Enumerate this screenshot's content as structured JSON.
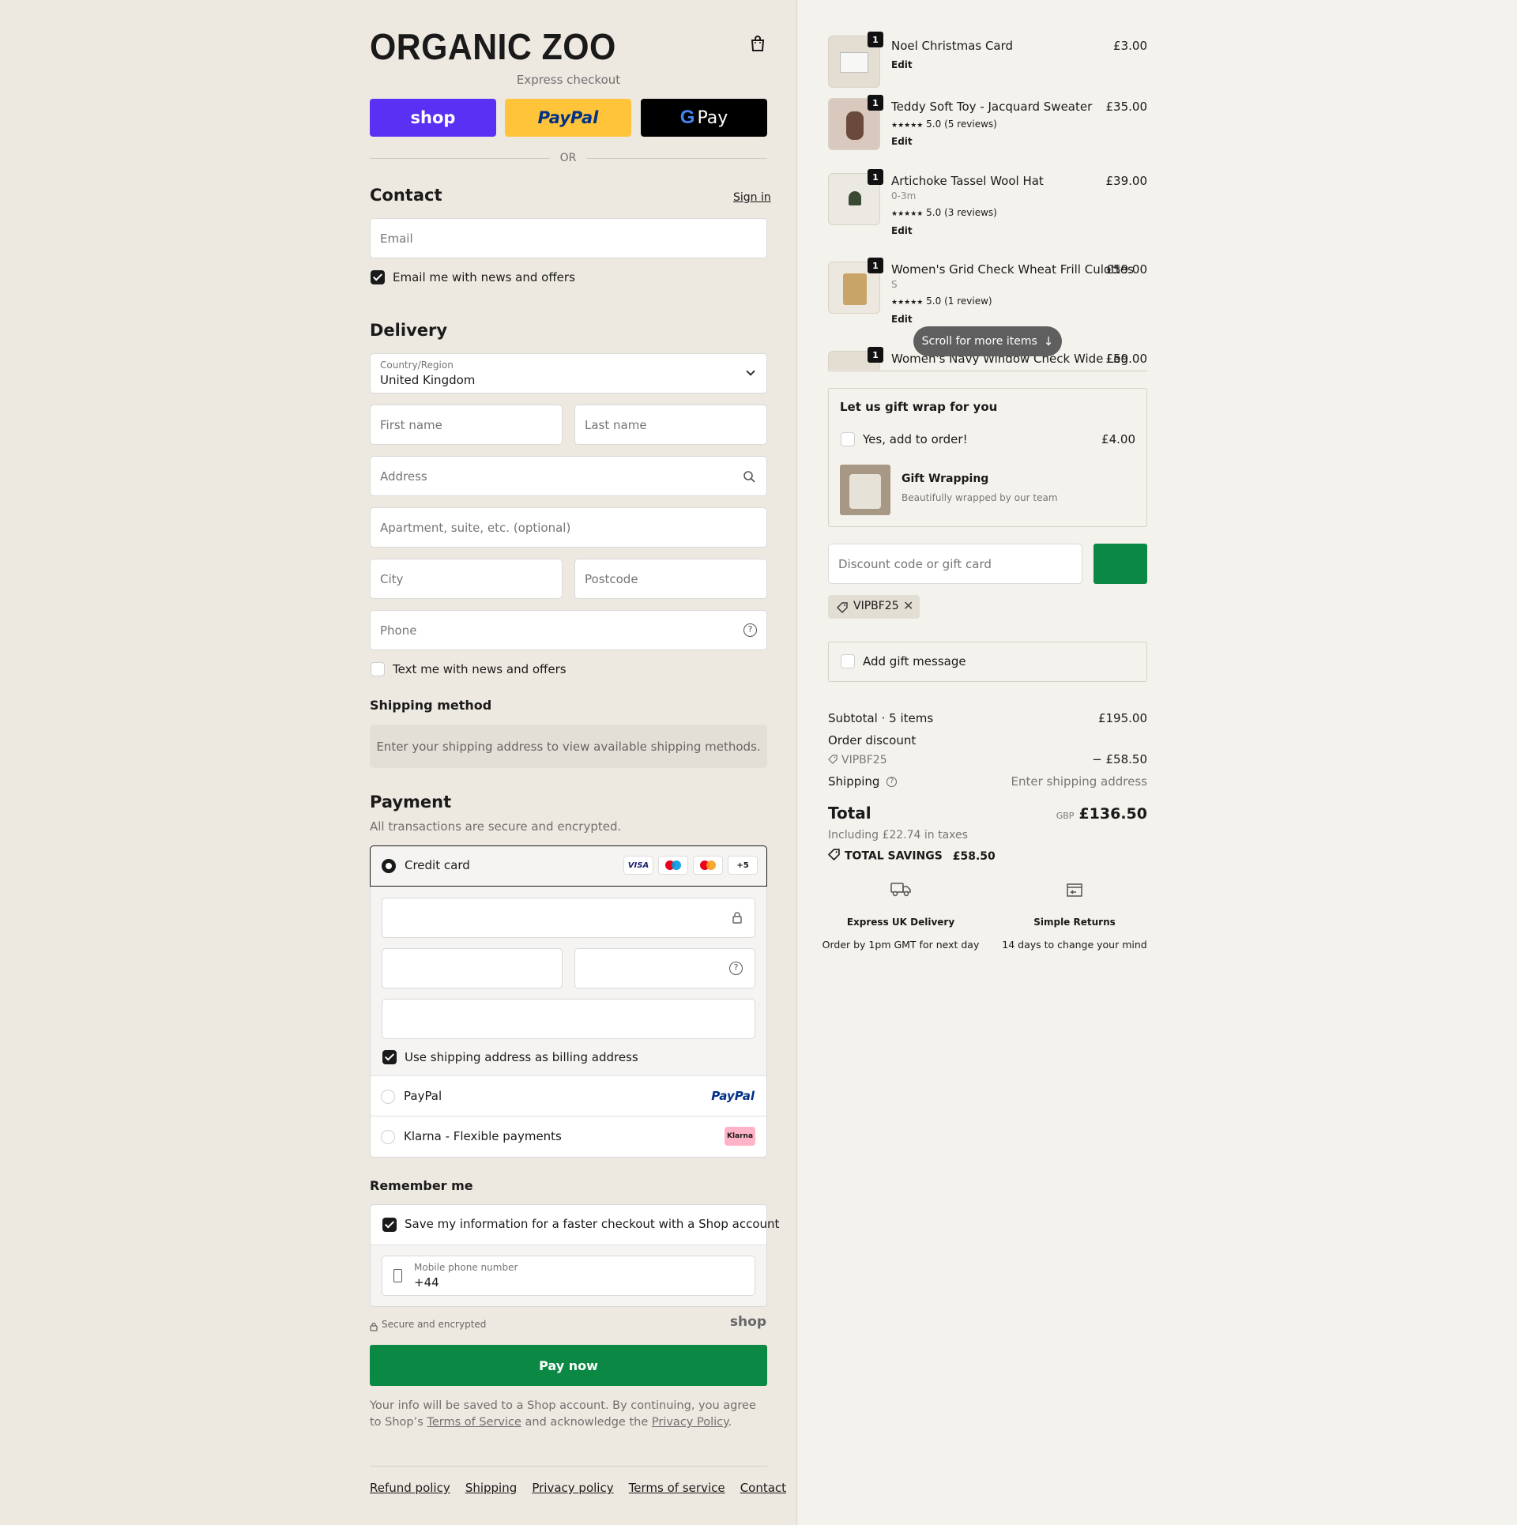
{
  "brand": {
    "logo": "ORGANIC ZOO"
  },
  "express": {
    "label": "Express checkout",
    "shop_label": "shop",
    "paypal_label": "PayPal",
    "gpay_label": "Pay",
    "or_label": "OR",
    "shop_color": "#5a31f4",
    "paypal_color": "#ffc439",
    "gpay_color": "#000000"
  },
  "contact": {
    "title": "Contact",
    "sign_in": "Sign in",
    "email_placeholder": "Email",
    "email_news_label": "Email me with news and offers",
    "email_news_checked": true
  },
  "delivery": {
    "title": "Delivery",
    "country_label": "Country/Region",
    "country_value": "United Kingdom",
    "first_name_placeholder": "First name",
    "last_name_placeholder": "Last name",
    "address_placeholder": "Address",
    "apartment_placeholder": "Apartment, suite, etc. (optional)",
    "city_placeholder": "City",
    "postcode_placeholder": "Postcode",
    "phone_placeholder": "Phone",
    "text_news_label": "Text me with news and offers",
    "text_news_checked": false
  },
  "shipping_method": {
    "title": "Shipping method",
    "notice": "Enter your shipping address to view available shipping methods."
  },
  "payment": {
    "title": "Payment",
    "subtitle": "All transactions are secure and encrypted.",
    "credit_card_label": "Credit card",
    "card_badges": [
      "VISA",
      "+5"
    ],
    "billing_label": "Use shipping address as billing address",
    "billing_checked": true,
    "paypal_option": "PayPal",
    "paypal_logo": "PayPal",
    "klarna_option": "Klarna - Flexible payments",
    "klarna_logo": "Klarna"
  },
  "remember": {
    "title": "Remember me",
    "save_label": "Save my information for a faster checkout with a Shop account",
    "save_checked": true,
    "mobile_label": "Mobile phone number",
    "mobile_value": "+44",
    "secure_label": "Secure and encrypted",
    "shop_mark": "shop"
  },
  "pay_button": {
    "label": "Pay now",
    "color": "#0b8843"
  },
  "legal": {
    "text_1": "Your info will be saved to a Shop account. By continuing, you agree to Shop’s",
    "terms": "Terms of Service",
    "text_2": "and acknowledge the",
    "privacy": "Privacy Policy",
    "text_3": "."
  },
  "footer": {
    "links": [
      "Refund policy",
      "Shipping",
      "Privacy policy",
      "Terms of service",
      "Contact"
    ]
  },
  "cart": {
    "items": [
      {
        "qty": "1",
        "name": "Noel Christmas Card",
        "price": "£3.00",
        "edit": "Edit"
      },
      {
        "qty": "1",
        "name": "Teddy Soft Toy - Jacquard Sweater",
        "price": "£35.00",
        "stars": "★★★★★",
        "rating": "5.0 (5 reviews)",
        "edit": "Edit"
      },
      {
        "qty": "1",
        "name": "Artichoke Tassel Wool Hat",
        "price": "£39.00",
        "variant": "0-3m",
        "stars": "★★★★★",
        "rating": "5.0 (3 reviews)",
        "edit": "Edit"
      },
      {
        "qty": "1",
        "name": "Women's Grid Check Wheat Frill Culottes",
        "price": "£59.00",
        "variant": "S",
        "stars": "★★★★★",
        "rating": "5.0 (1 review)",
        "edit": "Edit"
      },
      {
        "qty": "1",
        "name": "Women's Navy Window Check Wide Leg",
        "price": "£59.00"
      }
    ],
    "scroll_hint": "Scroll for more items"
  },
  "gift_wrap": {
    "title": "Let us gift wrap for you",
    "add_label": "Yes, add to order!",
    "add_price": "£4.00",
    "product_name": "Gift Wrapping",
    "product_desc": "Beautifully wrapped by our team"
  },
  "discount": {
    "placeholder": "Discount code or gift card",
    "applied_code": "VIPBF25"
  },
  "gift_message": {
    "label": "Add gift message"
  },
  "summary": {
    "subtotal_label": "Subtotal · 5 items",
    "subtotal_value": "£195.00",
    "order_discount_label": "Order discount",
    "discount_code": "VIPBF25",
    "discount_value": "− £58.50",
    "shipping_label": "Shipping",
    "shipping_value": "Enter shipping address",
    "total_label": "Total",
    "currency": "GBP",
    "total_value": "£136.50",
    "taxes": "Including £22.74 in taxes",
    "savings_label": "TOTAL SAVINGS",
    "savings_value": "£58.50"
  },
  "perks": [
    {
      "title": "Express UK Delivery",
      "desc": "Order by 1pm GMT for next day",
      "icon": "delivery-truck-icon"
    },
    {
      "title": "Simple Returns",
      "desc": "14 days to change your mind",
      "icon": "returns-box-icon"
    }
  ]
}
